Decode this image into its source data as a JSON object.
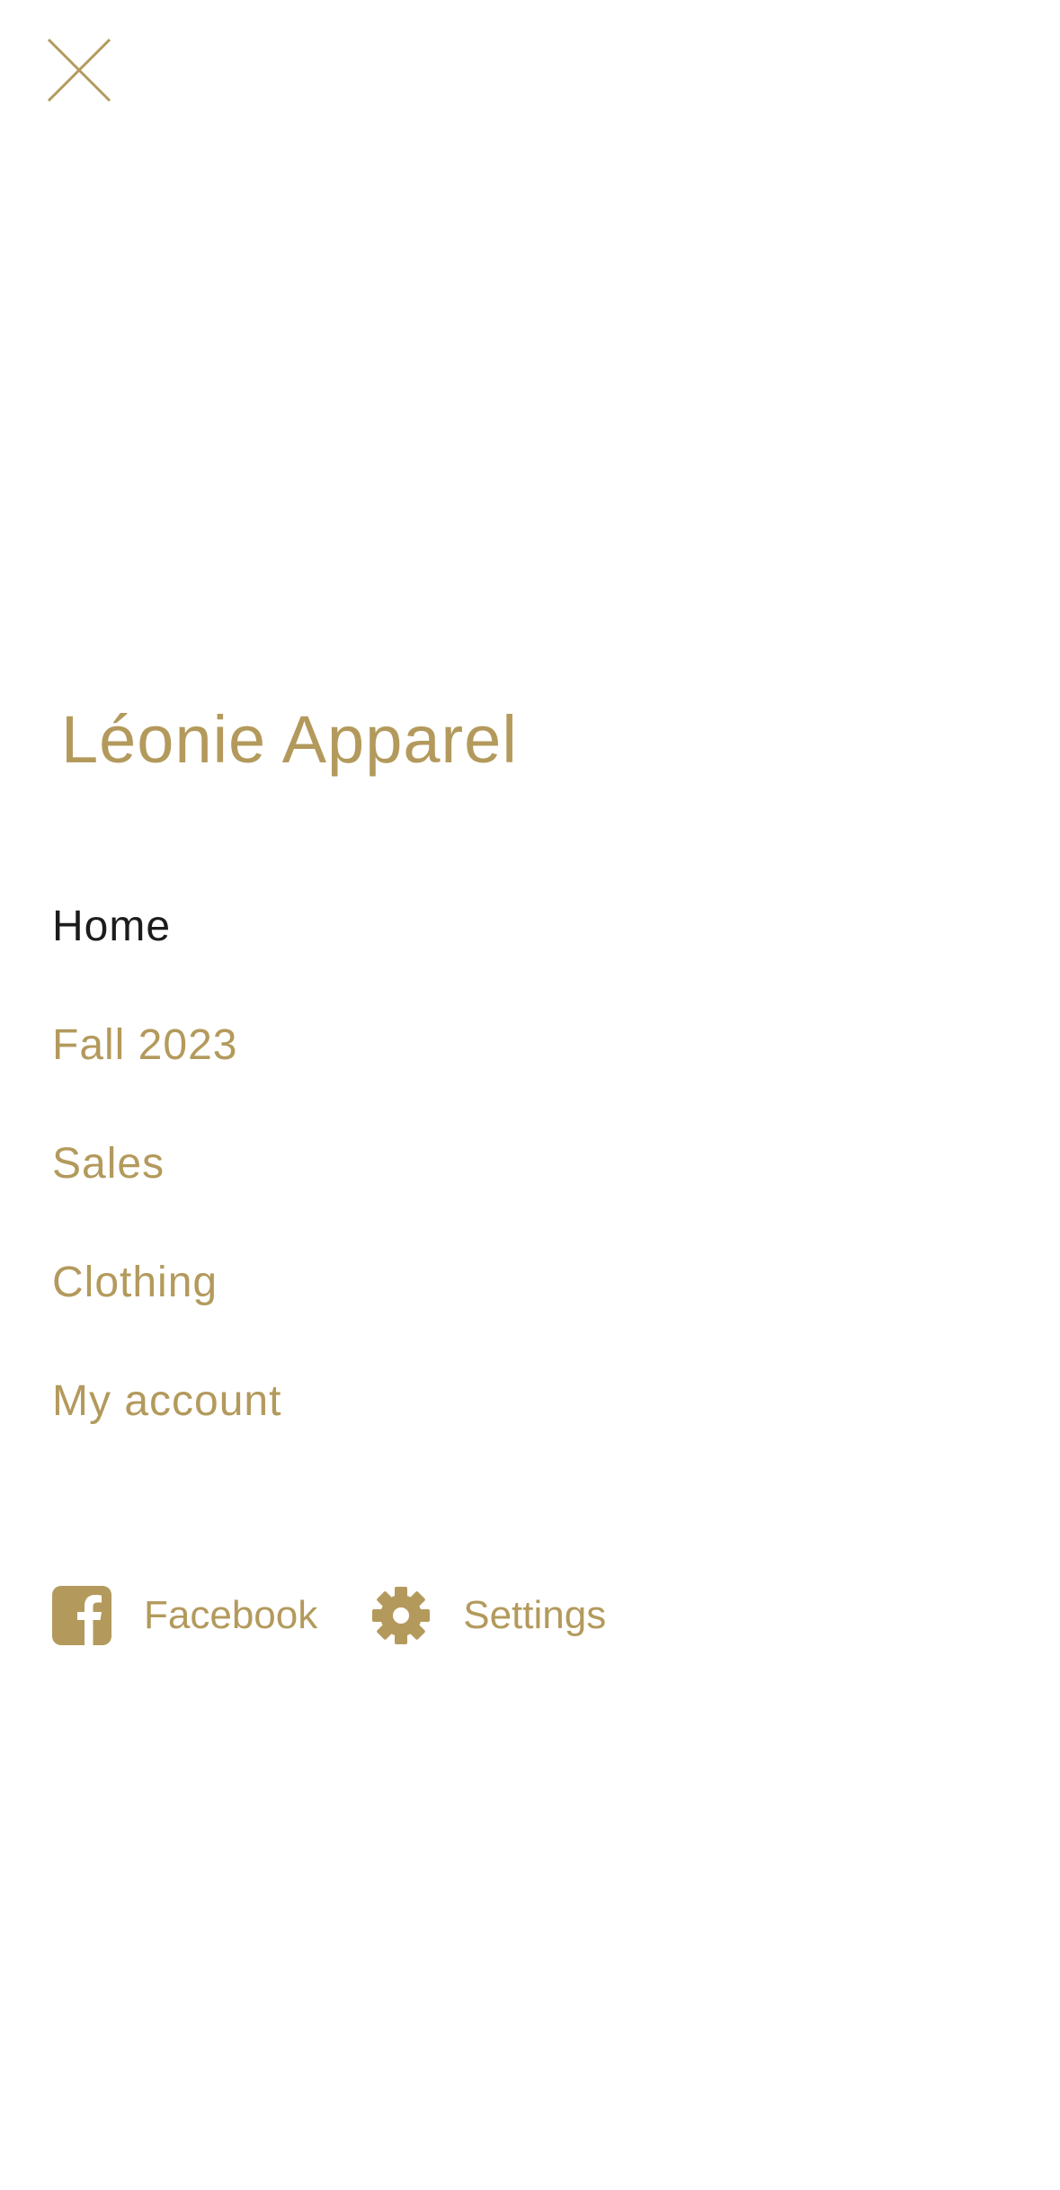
{
  "colors": {
    "accent": "#b39a5c",
    "active_text": "#1c1c1c",
    "background": "#ffffff"
  },
  "close": {
    "icon": "close-icon"
  },
  "brand": {
    "name": "Léonie Apparel"
  },
  "menu": {
    "items": [
      {
        "label": "Home",
        "active": true
      },
      {
        "label": "Fall 2023",
        "active": false
      },
      {
        "label": "Sales",
        "active": false
      },
      {
        "label": "Clothing",
        "active": false
      },
      {
        "label": "My account",
        "active": false
      }
    ]
  },
  "footer_links": [
    {
      "label": "Facebook",
      "icon": "facebook-icon"
    },
    {
      "label": "Settings",
      "icon": "gear-icon"
    }
  ]
}
